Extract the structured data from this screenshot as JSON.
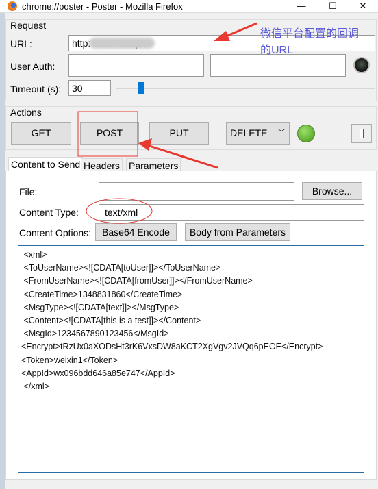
{
  "window": {
    "title": "chrome://poster - Poster - Mozilla Firefox",
    "minimize": "—",
    "maximize": "☐",
    "close": "✕"
  },
  "request": {
    "section_label": "Request",
    "url_label": "URL:",
    "url_value": "http:               /weixin.aspx",
    "user_auth_label": "User Auth:",
    "user_value": "",
    "password_value": "",
    "timeout_label": "Timeout (s):",
    "timeout_value": "30",
    "timeout_slider_fraction": 0.1
  },
  "actions": {
    "section_label": "Actions",
    "get": "GET",
    "post": "POST",
    "put": "PUT",
    "method_select": "DELETE",
    "status_color": "#6cc644"
  },
  "tabs": [
    {
      "label": "Content to Send",
      "active": true
    },
    {
      "label": "Headers"
    },
    {
      "label": "Parameters"
    }
  ],
  "content": {
    "file_label": "File:",
    "file_value": "",
    "browse": "Browse...",
    "content_type_label": "Content Type:",
    "content_type_value": "text/xml",
    "content_options_label": "Content Options:",
    "base64": "Base64 Encode",
    "body_from_params": "Body from Parameters",
    "body": " <xml>\n <ToUserName><![CDATA[toUser]]></ToUserName>\n <FromUserName><![CDATA[fromUser]]></FromUserName>\n <CreateTime>1348831860</CreateTime>\n <MsgType><![CDATA[text]]></MsgType>\n <Content><![CDATA[this is a test]]></Content>\n <MsgId>1234567890123456</MsgId>\n<Encrypt>tRzUx0aXODsHt3rK6VxsDW8aKCT2XgVgv2JVQq6pEOE</Encrypt>\n<Token>weixin1</Token>\n<AppId>wx096bdd646a85e747</AppId>\n </xml>"
  },
  "annotation": {
    "callout_line1": "微信平台配置的回调",
    "callout_line2": "的URL",
    "annotation_color": "#e8382f",
    "callout_color": "#5a5ad8"
  }
}
